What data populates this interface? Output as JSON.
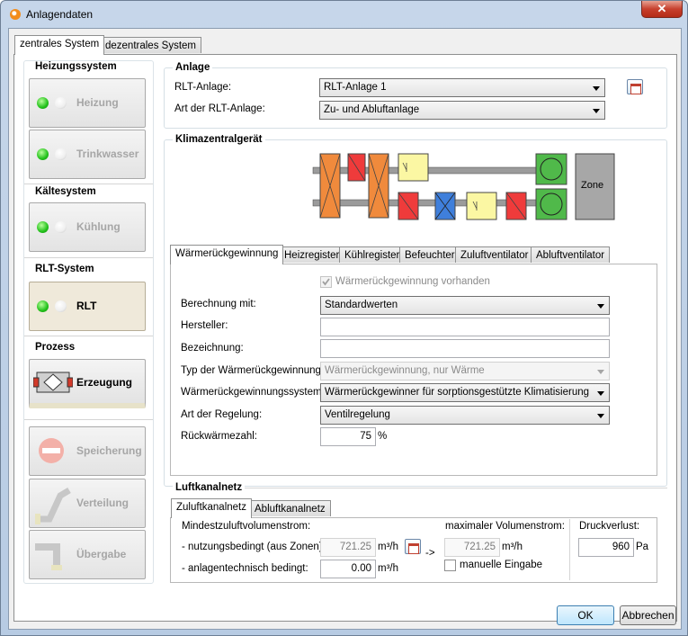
{
  "window": {
    "title": "Anlagendaten",
    "close": "✕"
  },
  "tabs": {
    "central": "zentrales System",
    "decentral": "dezentrales System"
  },
  "sidebar": {
    "heating_title": "Heizungssystem",
    "heating": "Heizung",
    "hot_water": "Trinkwasser",
    "cooling_title": "Kältesystem",
    "cooling": "Kühlung",
    "rlt_title": "RLT-System",
    "rlt": "RLT",
    "process_title": "Prozess",
    "generation": "Erzeugung",
    "storage": "Speicherung",
    "distribution": "Verteilung",
    "transfer": "Übergabe"
  },
  "anlage": {
    "title": "Anlage",
    "rlt_label": "RLT-Anlage:",
    "rlt_value": "RLT-Anlage 1",
    "type_label": "Art der RLT-Anlage:",
    "type_value": "Zu- und Abluftanlage"
  },
  "unit": {
    "title": "Klimazentralgerät",
    "zone": "Zone"
  },
  "subtabs": [
    "Wärmerückgewinnung",
    "Heizregister",
    "Kühlregister",
    "Befeuchter",
    "Zuluftventilator",
    "Abluftventilator"
  ],
  "wrg": {
    "present": "Wärmerückgewinnung vorhanden",
    "calc_label": "Berechnung mit:",
    "calc_value": "Standardwerten",
    "maker_label": "Hersteller:",
    "maker_value": "",
    "name_label": "Bezeichnung:",
    "name_value": "",
    "type_label": "Typ der Wärmerückgewinnung:",
    "type_value": "Wärmerückgewinnung, nur Wärme",
    "system_label": "Wärmerückgewinnungssystem:",
    "system_value": "Wärmerückgewinner für sorptionsgestützte Klimatisierung",
    "control_label": "Art der Regelung:",
    "control_value": "Ventilregelung",
    "ratio_label": "Rückwärmezahl:",
    "ratio_value": "75",
    "ratio_unit": "%"
  },
  "duct": {
    "title": "Luftkanalnetz",
    "tab_supply": "Zuluftkanalnetz",
    "tab_exhaust": "Abluftkanalnetz",
    "min_label": "Mindestzuluftvolumenstrom:",
    "usage_label": "- nutzungsbedingt (aus Zonen):",
    "usage_value": "721.25",
    "unit": "m³/h",
    "tech_label": "- anlagentechnisch bedingt:",
    "tech_value": "0.00",
    "arrow": "->",
    "max_label": "maximaler Volumenstrom:",
    "max_value": "721.25",
    "manual": "manuelle Eingabe",
    "pressure_label": "Druckverlust:",
    "pressure_value": "960",
    "pressure_unit": "Pa"
  },
  "footer": {
    "ok": "OK",
    "cancel": "Abbrechen"
  }
}
